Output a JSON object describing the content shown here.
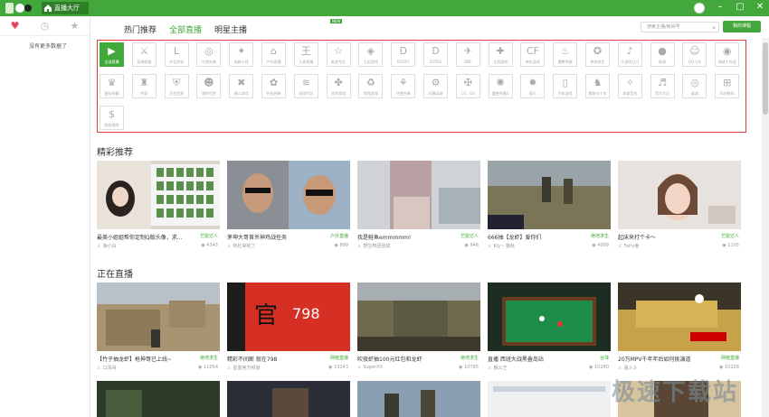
{
  "window": {
    "home_tab": "直播大厅"
  },
  "sidebar": {
    "empty_text": "没有更多数据了"
  },
  "nav": {
    "tabs": [
      "热门推荐",
      "全部直播",
      "明星主播"
    ],
    "new_badge": "NEW"
  },
  "search": {
    "placeholder": "搜索主播/房间号"
  },
  "my_live_button": "我的课程",
  "categories": [
    {
      "label": "全部直播",
      "icon": "▶"
    },
    {
      "label": "英雄联盟",
      "icon": "⚔"
    },
    {
      "label": "炉石传说",
      "icon": "L"
    },
    {
      "label": "守望先锋",
      "icon": "◎"
    },
    {
      "label": "穿越火线",
      "icon": "✦"
    },
    {
      "label": "户外直播",
      "icon": "⌂"
    },
    {
      "label": "王者荣耀",
      "icon": "王"
    },
    {
      "label": "新游专区",
      "icon": "☆"
    },
    {
      "label": "主机游戏",
      "icon": "◈"
    },
    {
      "label": "DOTA1",
      "icon": "D"
    },
    {
      "label": "DOTA2",
      "icon": "D"
    },
    {
      "label": "DNF",
      "icon": "✈"
    },
    {
      "label": "主机游戏",
      "icon": "✚"
    },
    {
      "label": "单机游戏",
      "icon": "CF"
    },
    {
      "label": "魔兽争霸",
      "icon": "♨"
    },
    {
      "label": "绝地求生",
      "icon": "✪"
    },
    {
      "label": "天涯明月刀",
      "icon": "♪"
    },
    {
      "label": "新游",
      "icon": "●"
    },
    {
      "label": "QQ飞车",
      "icon": "☺"
    },
    {
      "label": "球球大作战",
      "icon": "◉"
    },
    {
      "label": "星际争霸",
      "icon": "♛"
    },
    {
      "label": "传奇",
      "icon": "♜"
    },
    {
      "label": "坦克世界",
      "icon": "⛨"
    },
    {
      "label": "我的世界",
      "icon": "☻"
    },
    {
      "label": "格斗游戏",
      "icon": "✖"
    },
    {
      "label": "怀旧经典",
      "icon": "✿"
    },
    {
      "label": "网游专区",
      "icon": "≋"
    },
    {
      "label": "战争游戏",
      "icon": "✤"
    },
    {
      "label": "视频游戏",
      "icon": "♻"
    },
    {
      "label": "守望先锋",
      "icon": "⚘"
    },
    {
      "label": "风暴英雄",
      "icon": "⚙"
    },
    {
      "label": "CS：GO",
      "icon": "✠"
    },
    {
      "label": "魔兽争霸3",
      "icon": "✺"
    },
    {
      "label": "娱乐",
      "icon": "✹"
    },
    {
      "label": "手机游戏",
      "icon": "▯"
    },
    {
      "label": "跑跑卡丁车",
      "icon": "♞"
    },
    {
      "label": "体育竞技",
      "icon": "✧"
    },
    {
      "label": "音乐专区",
      "icon": "♬"
    },
    {
      "label": "桌游",
      "icon": "◎"
    },
    {
      "label": "科技数码",
      "icon": "⊞"
    },
    {
      "label": "财经理财",
      "icon": "$"
    }
  ],
  "sections": {
    "featured": "精彩推荐",
    "live": "正在直播"
  },
  "featured_cards": [
    {
      "title": "最美小姐姐帮你定制Q版头像，求...",
      "category": "艺能达人",
      "author": "海小白",
      "views": "4343"
    },
    {
      "title": "茅坤大哥首杀神鸡战任务",
      "category": "户外直播",
      "author": "阿杜来啦了",
      "views": "899"
    },
    {
      "title": "我是鲑鱼emmmmm!",
      "category": "艺能达人",
      "author": "野生鸭团团成",
      "views": "946"
    },
    {
      "title": "666抽【龙虾】爱你们",
      "category": "绝地求生",
      "author": "Kly~ 猫哒",
      "views": "4099"
    },
    {
      "title": "起床来打个卡～",
      "category": "艺能达人",
      "author": "Fairy姜",
      "views": "1105"
    }
  ],
  "live_cards": [
    {
      "title": "【竹子抽龙虾】枪神哥已上线~",
      "category": "绝地求生",
      "author": "口渴哥",
      "views": "11054"
    },
    {
      "title": "精彩不间断 就在798",
      "category": "网络直播",
      "author": "星客官方频道",
      "views": "13243"
    },
    {
      "title": "吹夜虾抽100元红包和龙虾",
      "category": "绝地求生",
      "author": "SuperXX",
      "views": "10795"
    },
    {
      "title": "直播 西班大战黑叠岛站",
      "category": "台球",
      "author": "俄公王",
      "views": "10280"
    },
    {
      "title": "20万MPV千年年后如何挑演道",
      "category": "网络直播",
      "author": "温斗斗",
      "views": "10226"
    }
  ],
  "watermark": "极速下载站",
  "colors": {
    "brand": "#43a83b",
    "highlight": "#e23b3b"
  }
}
